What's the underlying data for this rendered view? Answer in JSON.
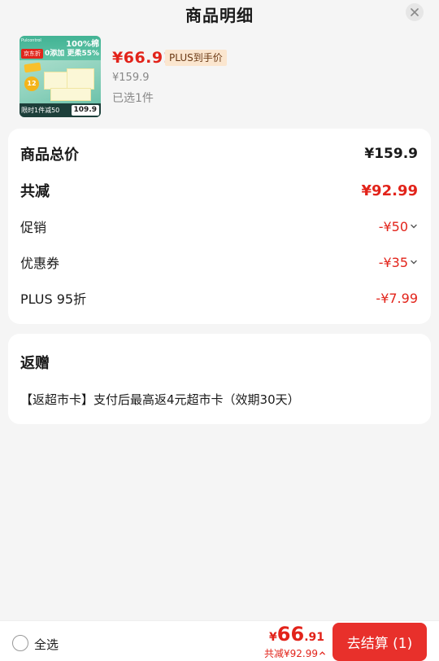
{
  "header": {
    "title": "商品明细"
  },
  "product": {
    "price": "¥66.91",
    "price_tag": "PLUS到手价",
    "original_price": "¥159.9",
    "selected": "已选1件",
    "thumbnail": {
      "brand_tag": "Pulcontrol",
      "jd_logo": "京东折",
      "headline_1": "100%棉",
      "headline_2": "0添加 更柔55%",
      "count_badge": "12",
      "promo_text": "限时1件减50",
      "price": "109.9"
    }
  },
  "totals": {
    "subtotal_label": "商品总价",
    "subtotal_value": "¥159.9",
    "discount_label": "共减",
    "discount_value": "¥92.99",
    "promo_label": "促销",
    "promo_value": "-¥50",
    "coupon_label": "优惠券",
    "coupon_value": "-¥35",
    "plus_label": "PLUS 95折",
    "plus_value": "-¥7.99"
  },
  "gift": {
    "title": "返赠",
    "text": "【返超市卡】支付后最高返4元超市卡（效期30天）"
  },
  "bottom_bar": {
    "select_all": "全选",
    "total_currency": "¥",
    "total_int": "66",
    "total_dec": ".91",
    "discount_text": "共减¥92.99",
    "checkout_label": "去结算 (1)"
  },
  "colors": {
    "accent_red": "#e2231a",
    "button_red": "#e8302b",
    "plus_tag_bg": "#fbe6cf",
    "background": "#f5f5f5"
  },
  "icons": {
    "close": "close-icon",
    "chevron": "chevron-down-icon",
    "chevron_up": "chevron-up-icon",
    "radio": "radio-unchecked-icon"
  }
}
